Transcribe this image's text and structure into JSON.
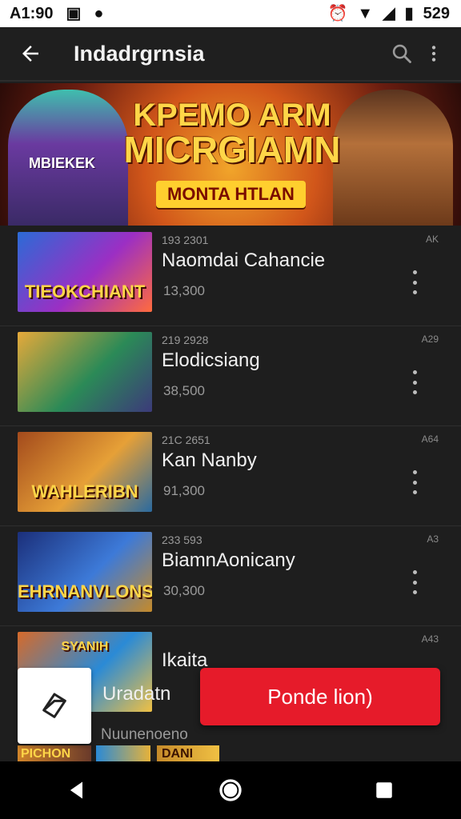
{
  "status_bar": {
    "time": "A1:90",
    "battery": "529"
  },
  "app_bar": {
    "title": "Indadrgrnsia"
  },
  "banner": {
    "line1": "KPEMO ARM",
    "line2": "MICRGIAMN",
    "ribbon": "MONTA HTLAN",
    "side_text": "MBIEKEK"
  },
  "list": [
    {
      "thumb_text": "TIEOKCHIANT",
      "meta": "193 2301",
      "name": "Naomdai Cahancie",
      "sub": "13,300",
      "corner": "AK",
      "colors": [
        "#2b6bd6",
        "#9b2fc4",
        "#ff6b3d"
      ]
    },
    {
      "thumb_text": "",
      "meta": "219 2928",
      "name": "Elodicsiang",
      "sub": "38,500",
      "corner": "A29",
      "colors": [
        "#e6a93a",
        "#2b8a57",
        "#3c3a7a"
      ]
    },
    {
      "thumb_text": "WAHLERIBN",
      "meta": "21C 2651",
      "name": "Kan Nanby",
      "sub": "91,300",
      "corner": "A64",
      "colors": [
        "#a34a1c",
        "#e6a037",
        "#2a6aa0"
      ]
    },
    {
      "thumb_text": "EHRNANVLONS",
      "meta": "233 593",
      "name": "BiamnAonicany",
      "sub": "30,300",
      "corner": "A3",
      "colors": [
        "#1b2f7a",
        "#3d7ad8",
        "#c58a2a"
      ]
    },
    {
      "thumb_text": "SYANIH",
      "meta": "",
      "name": "Ikaita",
      "sub": "",
      "corner": "A43",
      "colors": [
        "#d66a2a",
        "#2a8ad6",
        "#f0c043"
      ]
    }
  ],
  "bottom_strip": {
    "text1": "PICHON",
    "text2": "DANI"
  },
  "floating": {
    "label": "Uradatn",
    "sub": "Nuunenoeno",
    "cta": "Ponde lion)"
  },
  "icons": {
    "back": "arrow-left-icon",
    "search": "search-icon",
    "more": "more-vert-icon",
    "nav_back": "nav-back-icon",
    "nav_home": "nav-home-icon",
    "nav_recents": "nav-recents-icon"
  }
}
